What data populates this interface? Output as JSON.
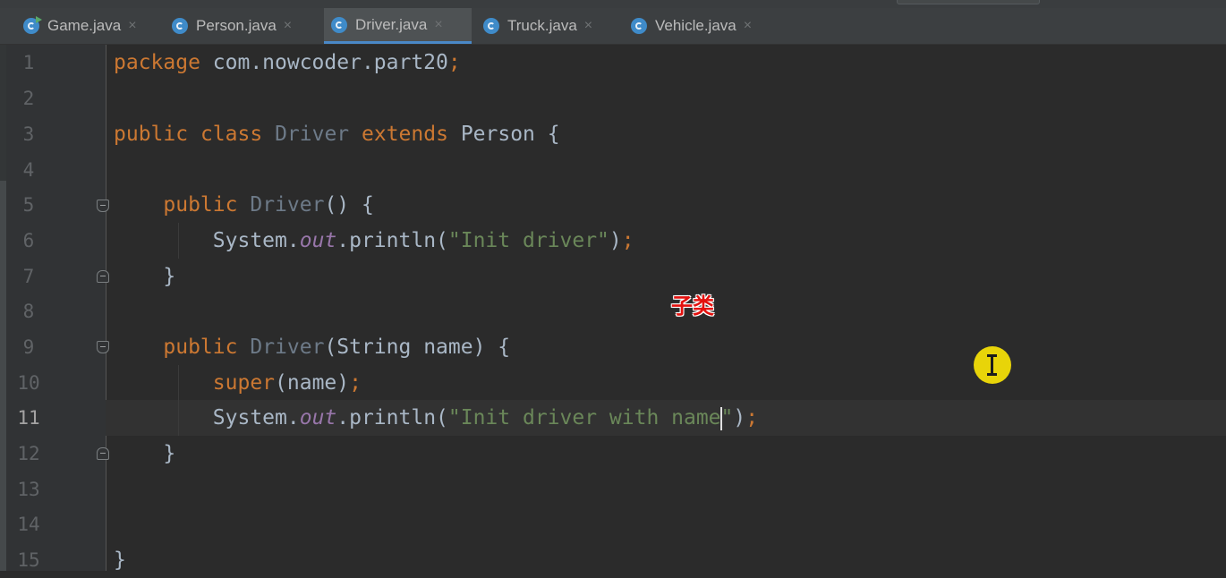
{
  "tabs": [
    {
      "label": "Game.java",
      "icon": "java-class-run-icon",
      "active": false
    },
    {
      "label": "Person.java",
      "icon": "java-class-icon",
      "active": false
    },
    {
      "label": "Driver.java",
      "icon": "java-class-icon",
      "active": true
    },
    {
      "label": "Truck.java",
      "icon": "java-class-icon",
      "active": false
    },
    {
      "label": "Vehicle.java",
      "icon": "java-class-icon",
      "active": false
    }
  ],
  "tab_close_glyph": "×",
  "line_numbers": [
    "1",
    "2",
    "3",
    "4",
    "5",
    "6",
    "7",
    "8",
    "9",
    "10",
    "11",
    "12",
    "13",
    "14",
    "15"
  ],
  "current_line": "11",
  "code": {
    "l1": {
      "kw": "package",
      "rest": " com.nowcoder.part20",
      "semi": ";"
    },
    "l3": {
      "kw1": "public",
      "kw2": "class",
      "name": "Driver",
      "kw3": "extends",
      "parent": "Person",
      "brace": "{"
    },
    "l5": {
      "kw": "public",
      "name": "Driver",
      "rest": "() {"
    },
    "l6": {
      "obj": "System.",
      "field": "out",
      "call": ".println(",
      "str": "\"Init driver\"",
      "end": ")",
      "semi": ";"
    },
    "l7": {
      "text": "}"
    },
    "l9": {
      "kw": "public",
      "name": "Driver",
      "rest": "(String name) {"
    },
    "l10": {
      "kw": "super",
      "rest": "(name)",
      "semi": ";"
    },
    "l11": {
      "obj": "System.",
      "field": "out",
      "call": ".println(",
      "str_before_caret": "\"Init driver with name",
      "str_after_caret": "\"",
      "end": ")",
      "semi": ";"
    },
    "l12": {
      "text": "}"
    },
    "l14": {
      "text": "}"
    }
  },
  "annotation": "子类",
  "colors": {
    "background": "#2b2b2b",
    "keyword": "#cc7832",
    "string": "#6a8759",
    "field": "#9876aa",
    "text": "#a9b7c6",
    "tab_accent": "#4a88c7",
    "annotation": "#e3110e",
    "cursor_highlight": "#e8d409"
  }
}
